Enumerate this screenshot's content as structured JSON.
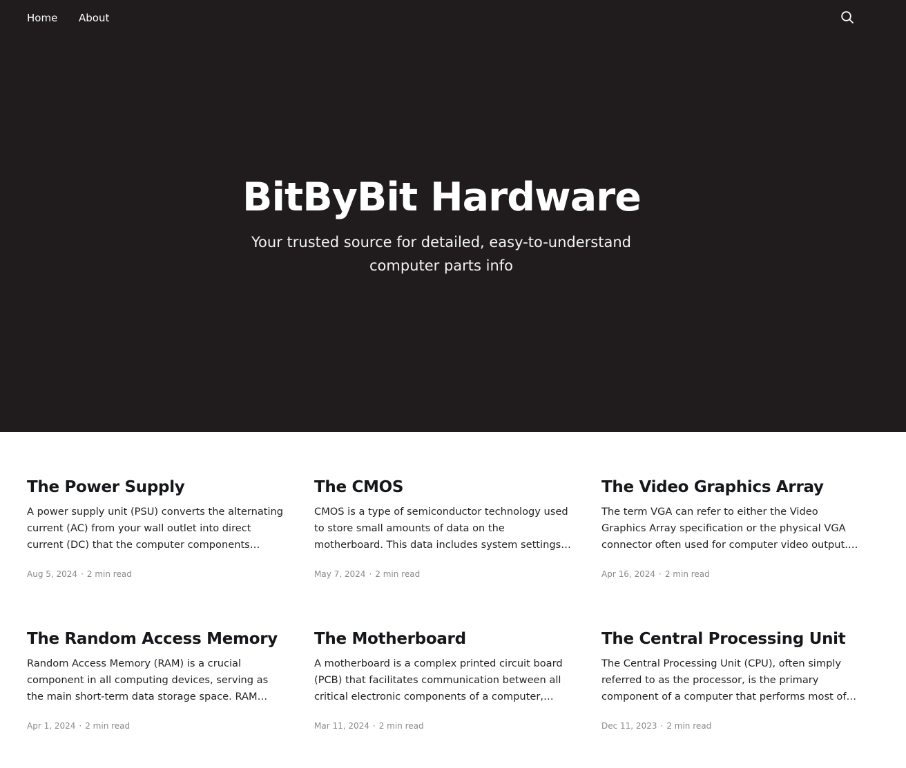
{
  "nav": {
    "home_label": "Home",
    "about_label": "About",
    "search_icon": "search-icon"
  },
  "hero": {
    "title": "BitByBit Hardware",
    "subtitle": "Your trusted source for detailed, easy-to-understand computer parts info",
    "background_color": "#201c1e"
  },
  "posts": [
    {
      "title": "The Power Supply",
      "excerpt": "A power supply unit (PSU) converts the alternating current (AC) from your wall outlet into direct current (DC) that the computer components…",
      "date": "Aug 5, 2024",
      "read_time": "2 min read"
    },
    {
      "title": "The CMOS",
      "excerpt": "CMOS is a type of semiconductor technology used to store small amounts of data on the motherboard. This data includes system settings and…",
      "date": "May 7, 2024",
      "read_time": "2 min read"
    },
    {
      "title": "The Video Graphics Array",
      "excerpt": "The term VGA can refer to either the Video Graphics Array specification or the physical VGA connector often used for computer video output. Below, I'll…",
      "date": "Apr 16, 2024",
      "read_time": "2 min read"
    },
    {
      "title": "The Random Access Memory",
      "excerpt": "Random Access Memory (RAM) is a crucial component in all computing devices, serving as the main short-term data storage space. RAM stores…",
      "date": "Apr 1, 2024",
      "read_time": "2 min read"
    },
    {
      "title": "The Motherboard",
      "excerpt": "A motherboard is a complex printed circuit board (PCB) that facilitates communication between all critical electronic components of a computer,…",
      "date": "Mar 11, 2024",
      "read_time": "2 min read"
    },
    {
      "title": "The Central Processing Unit",
      "excerpt": "The Central Processing Unit (CPU), often simply referred to as the processor, is the primary component of a computer that performs most of…",
      "date": "Dec 11, 2023",
      "read_time": "2 min read"
    }
  ],
  "meta_separator": "·"
}
